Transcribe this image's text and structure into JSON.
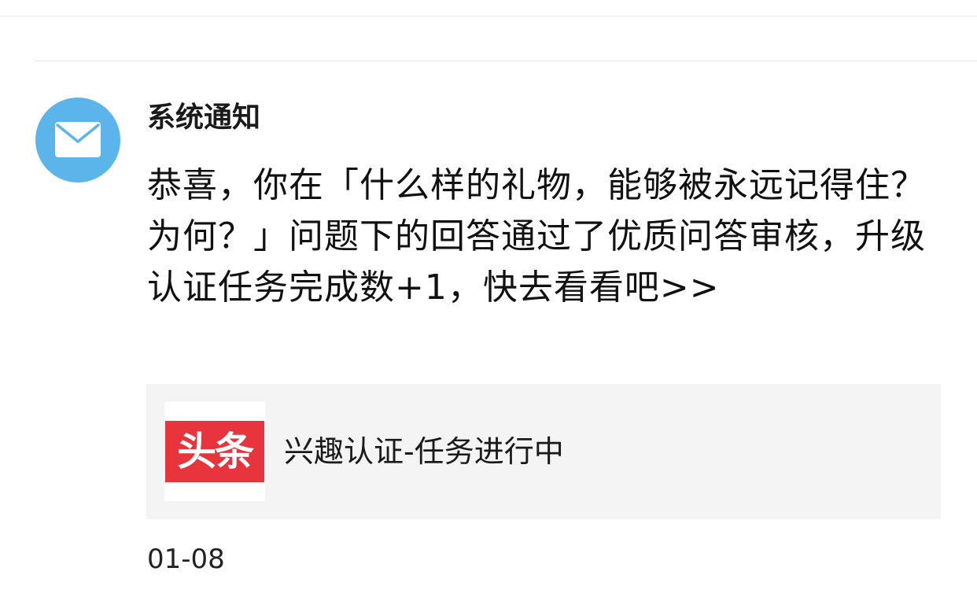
{
  "notification": {
    "sender": "系统通知",
    "avatar_icon": "envelope-icon",
    "message": "恭喜，你在「什么样的礼物，能够被永远记得住？为何？」问题下的回答通过了优质问答审核，升级认证任务完成数+1，快去看看吧>>",
    "card": {
      "logo_text": "头条",
      "logo_color": "#e8343d",
      "title": "兴趣认证-任务进行中"
    },
    "timestamp": "01-08"
  },
  "colors": {
    "avatar_bg": "#5bb5ea",
    "card_bg": "#f4f4f5"
  }
}
